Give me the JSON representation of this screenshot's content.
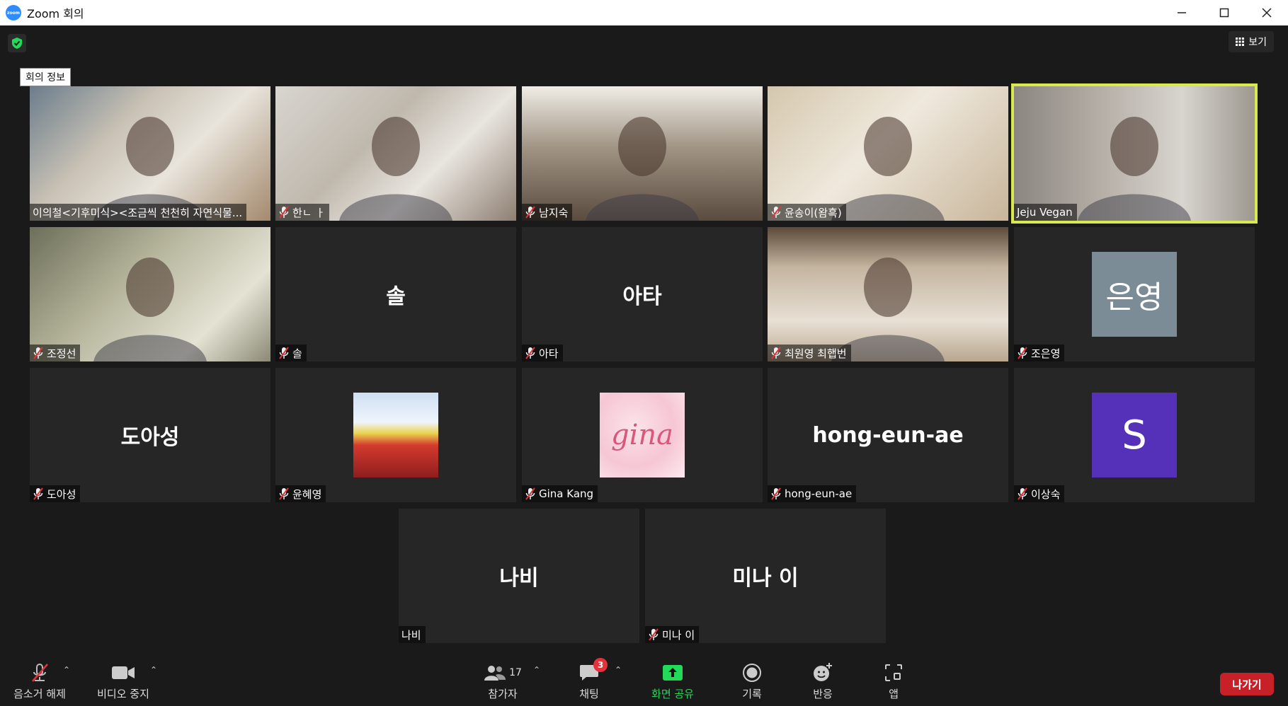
{
  "window": {
    "title": "Zoom 회의",
    "logo_text": "zoom"
  },
  "top": {
    "meeting_info_tooltip": "회의 정보",
    "view_label": "보기"
  },
  "tiles": [
    {
      "name": "이의철<기후미식><조금씩 천천히 자연식물...",
      "muted": false,
      "kind": "video"
    },
    {
      "name": "한ㄴ ㅏ",
      "muted": true,
      "kind": "video"
    },
    {
      "name": "남지숙",
      "muted": true,
      "kind": "video"
    },
    {
      "name": "윤송이(왐흑)",
      "muted": true,
      "kind": "video"
    },
    {
      "name": "Jeju Vegan",
      "muted": false,
      "kind": "video",
      "active_speaker": true
    },
    {
      "name": "조정선",
      "muted": true,
      "kind": "video"
    },
    {
      "name": "솔",
      "muted": true,
      "kind": "name",
      "display": "솔"
    },
    {
      "name": "아타",
      "muted": true,
      "kind": "name",
      "display": "아타"
    },
    {
      "name": "최원영 최햅번",
      "muted": true,
      "kind": "video"
    },
    {
      "name": "조은영",
      "muted": true,
      "kind": "avatar",
      "avatar_text": "은영",
      "avatar_color": "#7b8c96"
    },
    {
      "name": "도아성",
      "muted": true,
      "kind": "name",
      "display": "도아성"
    },
    {
      "name": "윤혜영",
      "muted": true,
      "kind": "photo"
    },
    {
      "name": "Gina Kang",
      "muted": true,
      "kind": "photo-gina",
      "avatar_text": "gina"
    },
    {
      "name": "hong-eun-ae",
      "muted": true,
      "kind": "name",
      "display": "hong-eun-ae"
    },
    {
      "name": "이상숙",
      "muted": true,
      "kind": "avatar",
      "avatar_text": "S",
      "avatar_color": "#5530b8"
    },
    {
      "name": "나비",
      "muted": false,
      "kind": "name",
      "display": "나비"
    },
    {
      "name": "미나 이",
      "muted": true,
      "kind": "name",
      "display": "미나 이"
    }
  ],
  "toolbar": {
    "unmute_label": "음소거 해제",
    "stop_video_label": "비디오 중지",
    "participants_label": "참가자",
    "participants_count": "17",
    "chat_label": "채팅",
    "chat_badge": "3",
    "share_label": "화면 공유",
    "record_label": "기록",
    "reactions_label": "반응",
    "apps_label": "앱",
    "leave_label": "나가기"
  },
  "colors": {
    "accent_green": "#23d959",
    "active_outline": "#d8e84f",
    "leave_red": "#c72029"
  }
}
